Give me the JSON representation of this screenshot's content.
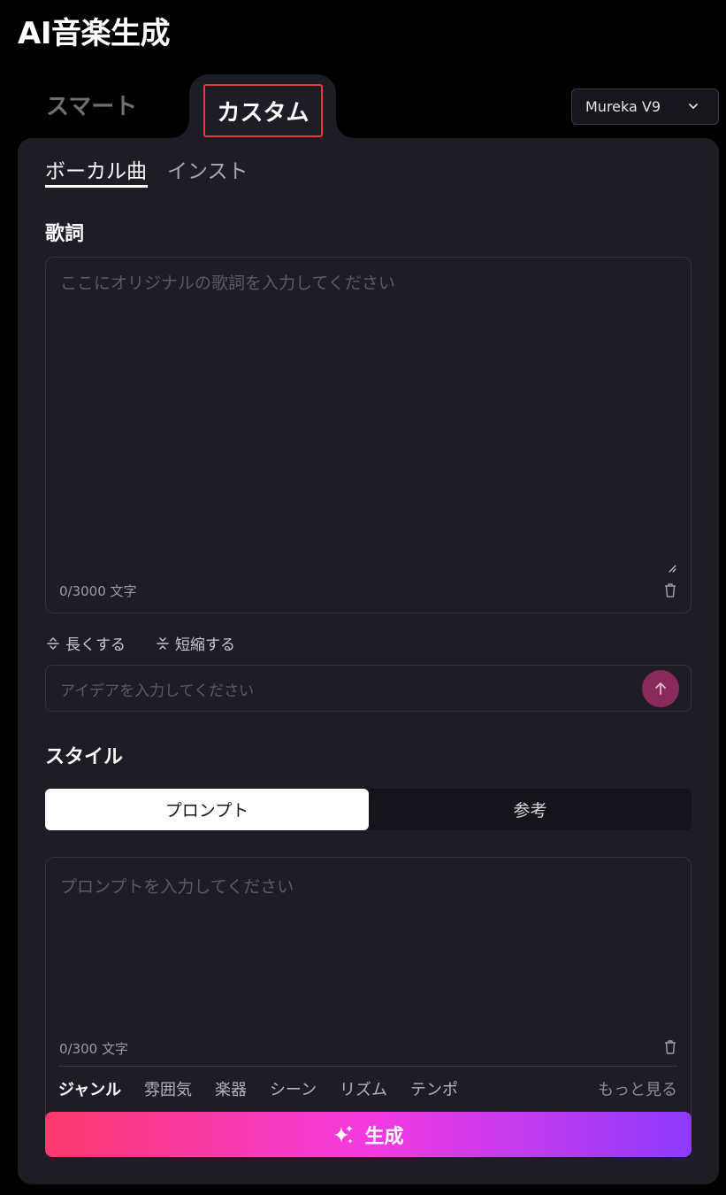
{
  "app": {
    "title": "AI音楽生成"
  },
  "mode_tabs": {
    "smart": "スマート",
    "custom": "カスタム"
  },
  "model_select": {
    "value": "Mureka V9"
  },
  "sub_tabs": {
    "vocal": "ボーカル曲",
    "instrumental": "インスト"
  },
  "lyrics": {
    "heading": "歌詞",
    "placeholder": "ここにオリジナルの歌詞を入力してください",
    "counter": "0/3000 文字"
  },
  "lyric_actions": {
    "extend": "長くする",
    "shorten": "短縮する"
  },
  "idea": {
    "placeholder": "アイデアを入力してください"
  },
  "style": {
    "heading": "スタイル",
    "segments": [
      "プロンプト",
      "参考"
    ],
    "prompt_placeholder": "プロンプトを入力してください",
    "counter": "0/300 文字",
    "categories": [
      "ジャンル",
      "雰囲気",
      "楽器",
      "シーン",
      "リズム",
      "テンポ"
    ],
    "more": "もっと見る"
  },
  "generate": {
    "label": "生成"
  },
  "colors": {
    "background": "#000000",
    "panel": "#1e1d26",
    "highlight_border": "#e53935",
    "send_button": "#8a2a5c",
    "generate_gradient": [
      "#fd3a6c",
      "#f43ae0",
      "#8d3bfd"
    ]
  },
  "icons": [
    "chevron-down-icon",
    "trash-icon",
    "resize-grip-icon",
    "extend-icon",
    "shorten-icon",
    "arrow-up-icon",
    "sparkle-icon"
  ]
}
